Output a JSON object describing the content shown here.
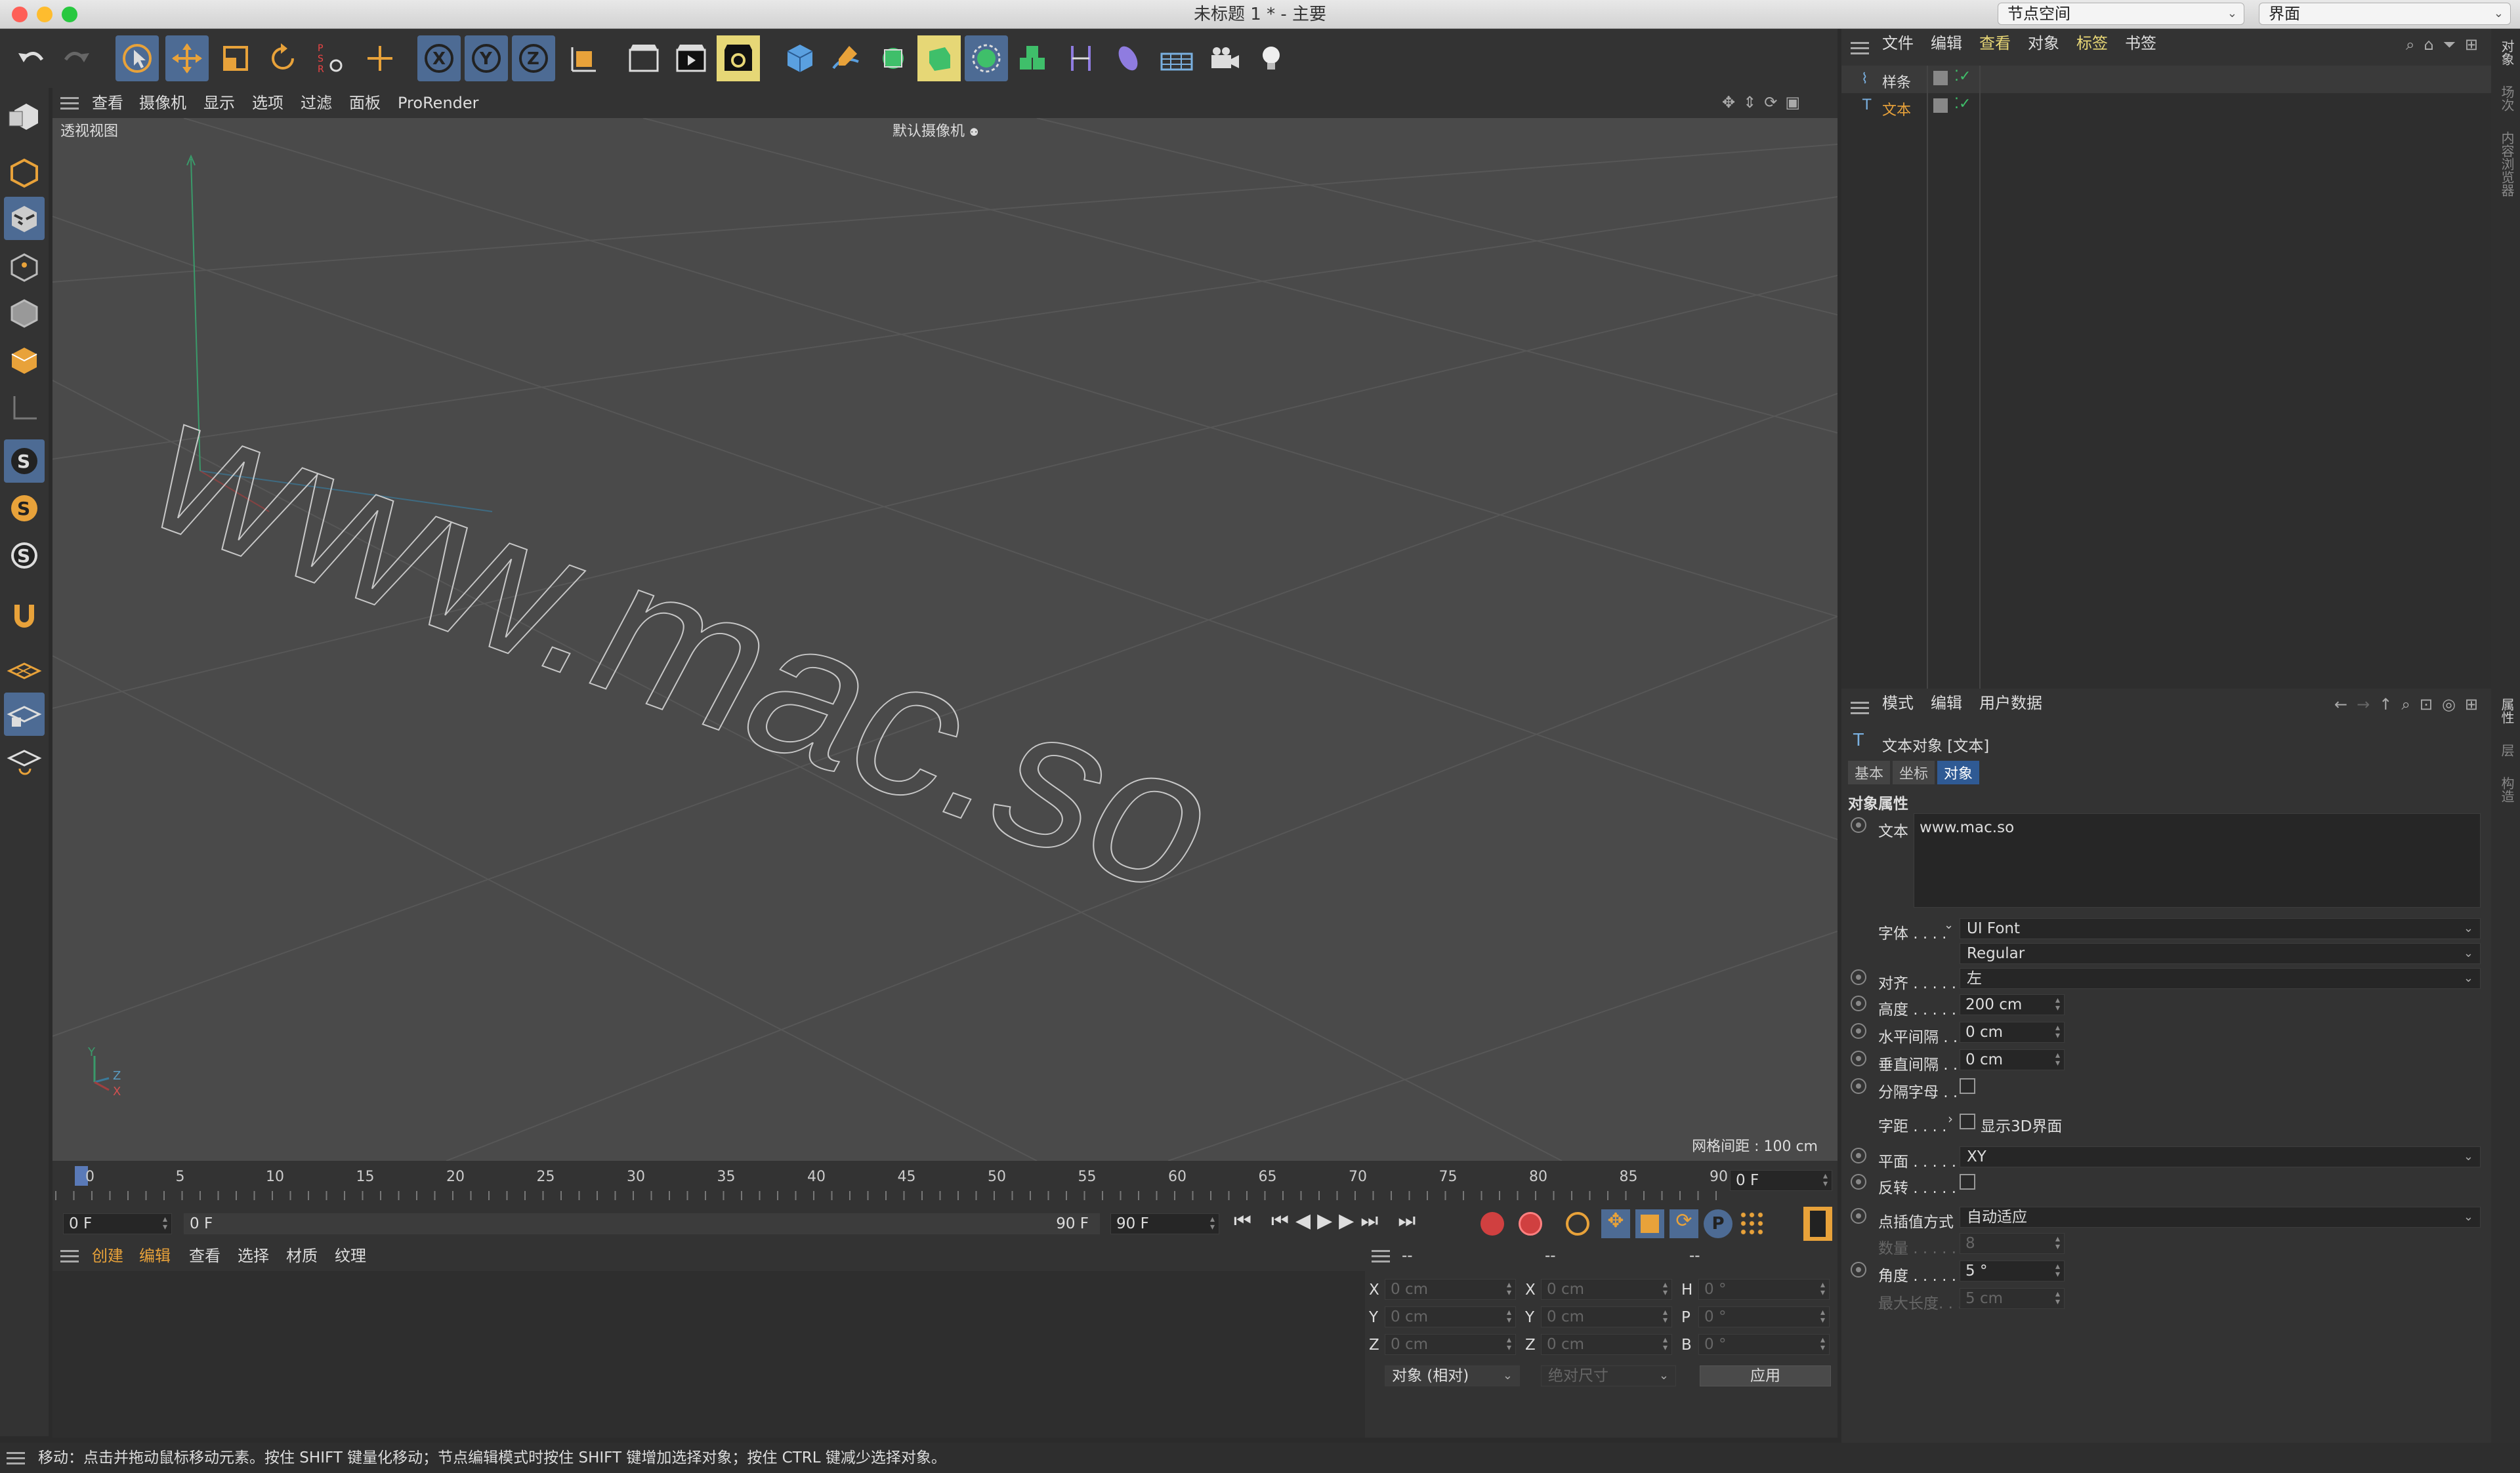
{
  "window": {
    "title": "未标题 1 * - 主要",
    "node_space": "节点空间",
    "layout": "界面"
  },
  "viewport_menu": [
    "查看",
    "摄像机",
    "显示",
    "选项",
    "过滤",
    "面板",
    "ProRender"
  ],
  "viewport": {
    "title": "透视视图",
    "camera": "默认摄像机",
    "grid_spacing": "网格间距 : 100 cm",
    "text_3d": "www.mac.so",
    "axis_y": "Y",
    "axis_z": "Z",
    "axis_x": "X"
  },
  "timeline": {
    "ticks": [
      "0",
      "5",
      "10",
      "15",
      "20",
      "25",
      "30",
      "35",
      "40",
      "45",
      "50",
      "55",
      "60",
      "65",
      "70",
      "75",
      "80",
      "85",
      "90"
    ],
    "current_frame": "0 F"
  },
  "playbar": {
    "start": "0 F",
    "range_start": "0 F",
    "range_end": "90 F",
    "end": "90 F"
  },
  "material_menu": [
    "创建",
    "编辑",
    "查看",
    "选择",
    "材质",
    "纹理"
  ],
  "coords": {
    "header": [
      "--",
      "--",
      "--"
    ],
    "rows": [
      {
        "a": "X",
        "av": "0 cm",
        "b": "X",
        "bv": "0 cm",
        "c": "H",
        "cv": "0 °"
      },
      {
        "a": "Y",
        "av": "0 cm",
        "b": "Y",
        "bv": "0 cm",
        "c": "P",
        "cv": "0 °"
      },
      {
        "a": "Z",
        "av": "0 cm",
        "b": "Z",
        "bv": "0 cm",
        "c": "B",
        "cv": "0 °"
      }
    ],
    "mode": "对象 (相对)",
    "size": "绝对尺寸",
    "apply": "应用"
  },
  "object_manager": {
    "menu": [
      "文件",
      "编辑",
      "查看",
      "对象",
      "标签",
      "书签"
    ],
    "items": [
      {
        "name": "样条",
        "icon": "spline-icon"
      },
      {
        "name": "文本",
        "icon": "text-icon"
      }
    ]
  },
  "attributes": {
    "menu": [
      "模式",
      "编辑",
      "用户数据"
    ],
    "object_title": "文本对象 [文本]",
    "tabs": [
      "基本",
      "坐标",
      "对象"
    ],
    "section": "对象属性",
    "text_label": "文本",
    "text_value": "www.mac.so",
    "font_label": "字体 . . . .",
    "font": "UI Font",
    "font_style": "Regular",
    "align_label": "对齐 . . . . .",
    "align": "左",
    "height_label": "高度 . . . . .",
    "height": "200 cm",
    "hspace_label": "水平间隔 . .",
    "hspace": "0 cm",
    "vspace_label": "垂直间隔 . .",
    "vspace": "0 cm",
    "sep_label": "分隔字母 . .",
    "kerning_label": "字距 . . . .",
    "show3d": "显示3D界面",
    "plane_label": "平面 . . . . .",
    "plane": "XY",
    "reverse_label": "反转 . . . . .",
    "interp_label": "点插值方式",
    "interp": "自动适应",
    "count_label": "数量 . . . . .",
    "count": "8",
    "angle_label": "角度 . . . . .",
    "angle": "5 °",
    "maxlen_label": "最大长度. . .",
    "maxlen": "5 cm"
  },
  "right_strip": [
    "对象",
    "场次",
    "内容浏览器",
    "属性",
    "层",
    "构造"
  ],
  "status": "移动：点击并拖动鼠标移动元素。按住 SHIFT 键量化移动；节点编辑模式时按住 SHIFT 键增加选择对象；按住 CTRL 键减少选择对象。",
  "colors": {
    "accent_orange": "#e8a23a",
    "accent_blue": "#4d6b94",
    "highlight_yellow": "#e6d776",
    "active_tab": "#2f5a94"
  }
}
